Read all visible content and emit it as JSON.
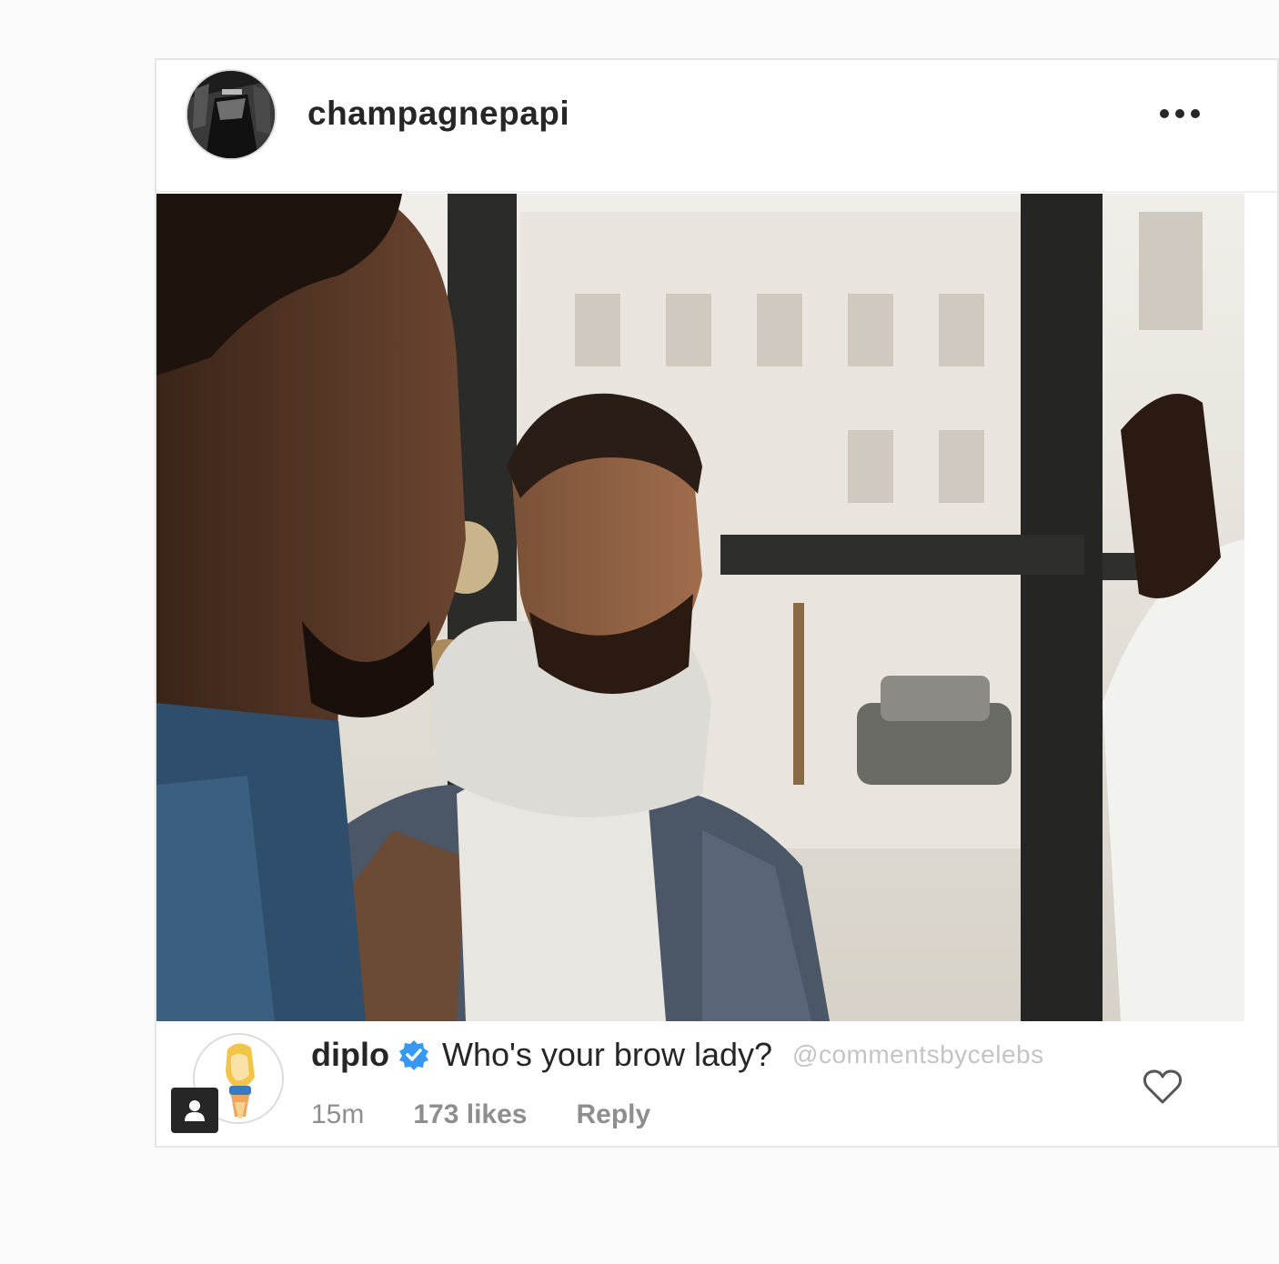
{
  "post": {
    "username": "champagnepapi",
    "avatar_icon": "profile-photo-avatar",
    "more_icon": "more-options-icon",
    "photo_icon": "post-photo"
  },
  "comment": {
    "username": "diplo",
    "verified_icon": "verified-badge-icon",
    "text": "Who's your brow lady?",
    "watermark": "@commentsbycelebs",
    "time": "15m",
    "likes": "173 likes",
    "reply_label": "Reply",
    "heart_icon": "heart-icon",
    "profile_badge_icon": "person-icon"
  },
  "colors": {
    "background": "#fafafa",
    "card": "#ffffff",
    "text_primary": "#262626",
    "text_secondary": "#8e8e8e",
    "verified_blue": "#3897f0",
    "watermark": "#c4c4c4"
  }
}
